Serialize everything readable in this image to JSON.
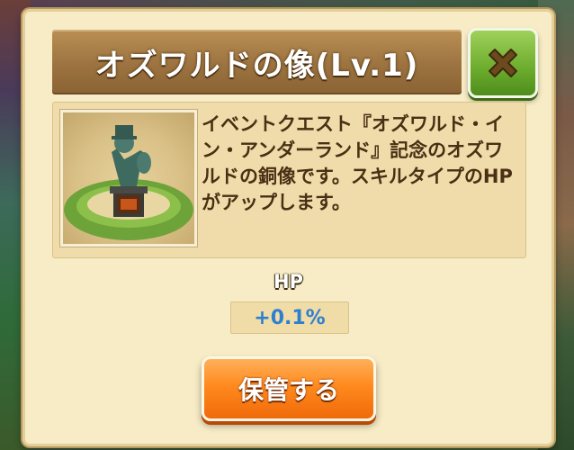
{
  "dialog": {
    "title": "オズワルドの像(Lv.1)",
    "close_icon": "x-icon",
    "item": {
      "image_icon": "bronze-statue-icon",
      "description": "イベントクエスト『オズワルド・イン・アンダーランド』記念のオズワルドの銅像です。スキルタイプのHPがアップします。"
    },
    "stat": {
      "label": "HP",
      "value": "+0.1%"
    },
    "store_button": "保管する"
  },
  "colors": {
    "title_bar": "#9c7340",
    "close_button": "#6bab2c",
    "store_button": "#ff8a1e",
    "stat_value": "#2f7fd0",
    "description_text": "#4a2f14"
  }
}
